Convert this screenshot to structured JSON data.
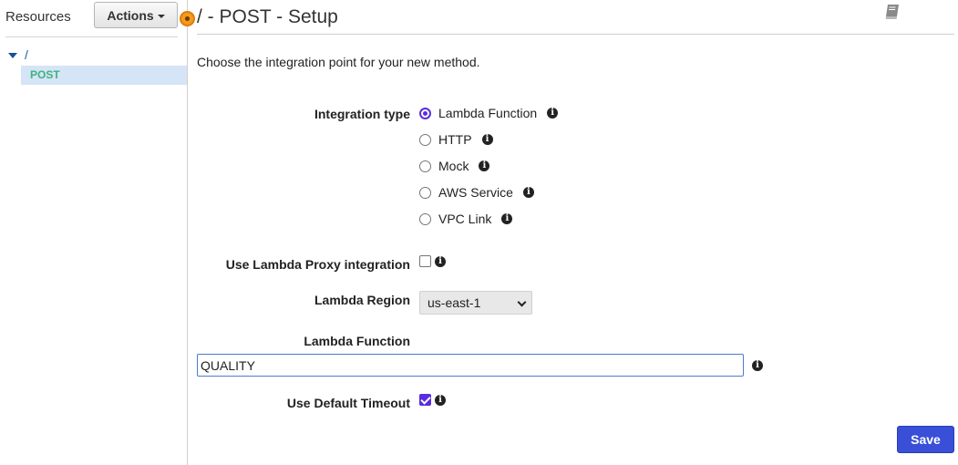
{
  "sidebar": {
    "title": "Resources",
    "actions_label": "Actions",
    "tree_root": "/",
    "tree_child": "POST"
  },
  "header": {
    "title": "/ - POST - Setup"
  },
  "intro_text": "Choose the integration point for your new method.",
  "integration": {
    "label": "Integration type",
    "options": [
      {
        "label": "Lambda Function",
        "selected": true
      },
      {
        "label": "HTTP",
        "selected": false
      },
      {
        "label": "Mock",
        "selected": false
      },
      {
        "label": "AWS Service",
        "selected": false
      },
      {
        "label": "VPC Link",
        "selected": false
      }
    ]
  },
  "proxy": {
    "label": "Use Lambda Proxy integration",
    "checked": false
  },
  "region": {
    "label": "Lambda Region",
    "value": "us-east-1"
  },
  "lambda_function": {
    "label": "Lambda Function",
    "value": "QUALITY"
  },
  "timeout": {
    "label": "Use Default Timeout",
    "checked": true
  },
  "save_label": "Save",
  "colors": {
    "accent": "#3a4fd8",
    "radio": "#5a2de0",
    "post": "#3bb57c",
    "marker": "#f29b1e"
  }
}
